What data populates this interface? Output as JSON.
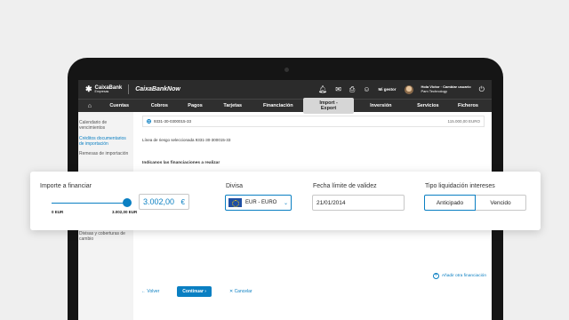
{
  "header": {
    "brand_name": "CaixaBank",
    "brand_sub": "Empresas",
    "app_name": "CaixaBankNow",
    "gestor_label": "Mi gestor",
    "user_greeting": "Hola Victor · Cambiar usuario",
    "user_company": "Pam Technology"
  },
  "nav": {
    "items": [
      "Cuentas",
      "Cobros",
      "Pagos",
      "Tarjetas",
      "Financiación",
      "Import - Export",
      "Inversión",
      "Servicios",
      "Ficheros"
    ]
  },
  "sidebar": {
    "items": [
      "Calendario de vencimientos",
      "Créditos documentarios de importación",
      "Remesas de importación"
    ],
    "divisas": "Divisas y coberturas de cambio"
  },
  "main": {
    "account": "9331-30-0300015-33",
    "account_amount": "115.000,00 EURO",
    "linea": "Línea de riesgo seleccionada 9331-30-300015-33",
    "indicanos": "Indícanos las financiaciones a realizar",
    "add_financiacion": "Añadir otra financiación",
    "volver": "Volver",
    "continuar": "Continuar",
    "cancelar": "Cancelar"
  },
  "card": {
    "importe_label": "Importe a financiar",
    "slider_min": "0 EUR",
    "slider_max": "3.002,00 EUR",
    "slider_fraction": 1.0,
    "amount": "3.002,00",
    "currency_symbol": "€",
    "divisa_label": "Divisa",
    "divisa_value": "EUR - EURO",
    "fecha_label": "Fecha límite de validez",
    "fecha_value": "21/01/2014",
    "tipo_label": "Tipo liquidación intereses",
    "tipo_options": [
      "Anticipado",
      "Vencido"
    ],
    "tipo_selected": "Anticipado"
  },
  "colors": {
    "accent": "#0a7fc2",
    "header": "#2b2b2b"
  }
}
